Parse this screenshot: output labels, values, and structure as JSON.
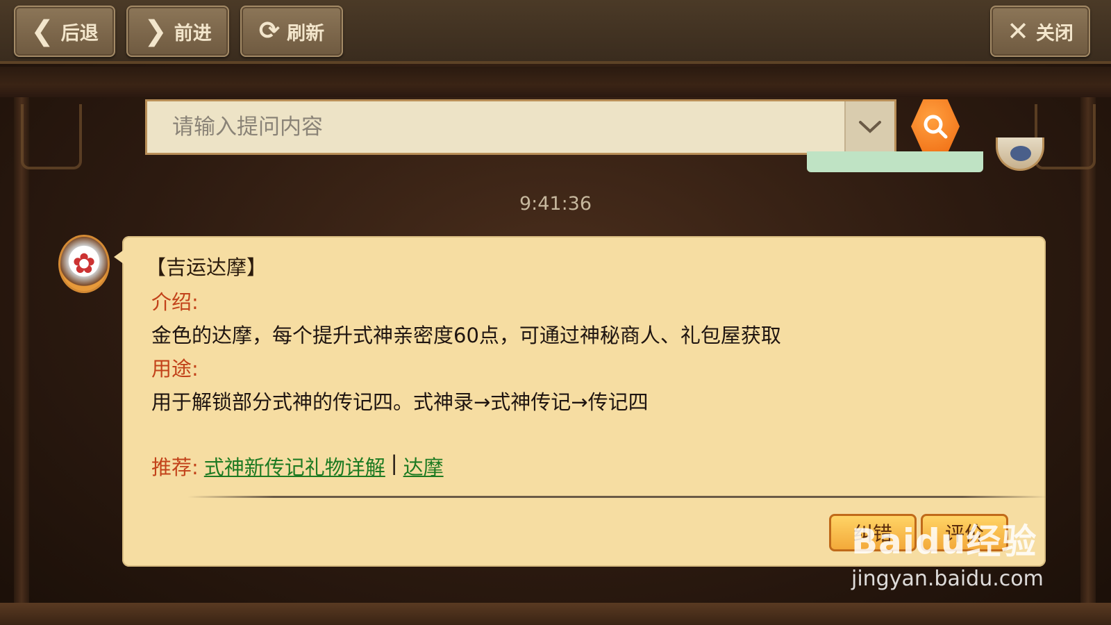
{
  "toolbar": {
    "back_label": "后退",
    "forward_label": "前进",
    "refresh_label": "刷新",
    "close_label": "关闭"
  },
  "search": {
    "placeholder": "请输入提问内容"
  },
  "chat": {
    "timestamp": "9:41:36",
    "title": "【吉运达摩】",
    "intro_label": "介绍:",
    "intro_text": "金色的达摩，每个提升式神亲密度60点，可通过神秘商人、礼包屋获取",
    "usage_label": "用途:",
    "usage_text": "用于解锁部分式神的传记四。式神录→式神传记→传记四",
    "recommend_label": "推荐:",
    "recommend_links": [
      "式神新传记礼物详解",
      "达摩"
    ],
    "separator": "|",
    "correct_button": "纠错",
    "rate_button": "评价"
  },
  "watermark": {
    "logo": "Baidu经验",
    "url": "jingyan.baidu.com"
  },
  "colors": {
    "accent_orange": "#ef6a10",
    "bubble_bg": "#f6dda2",
    "label_red": "#c2421a",
    "link_green": "#1d7a22"
  }
}
